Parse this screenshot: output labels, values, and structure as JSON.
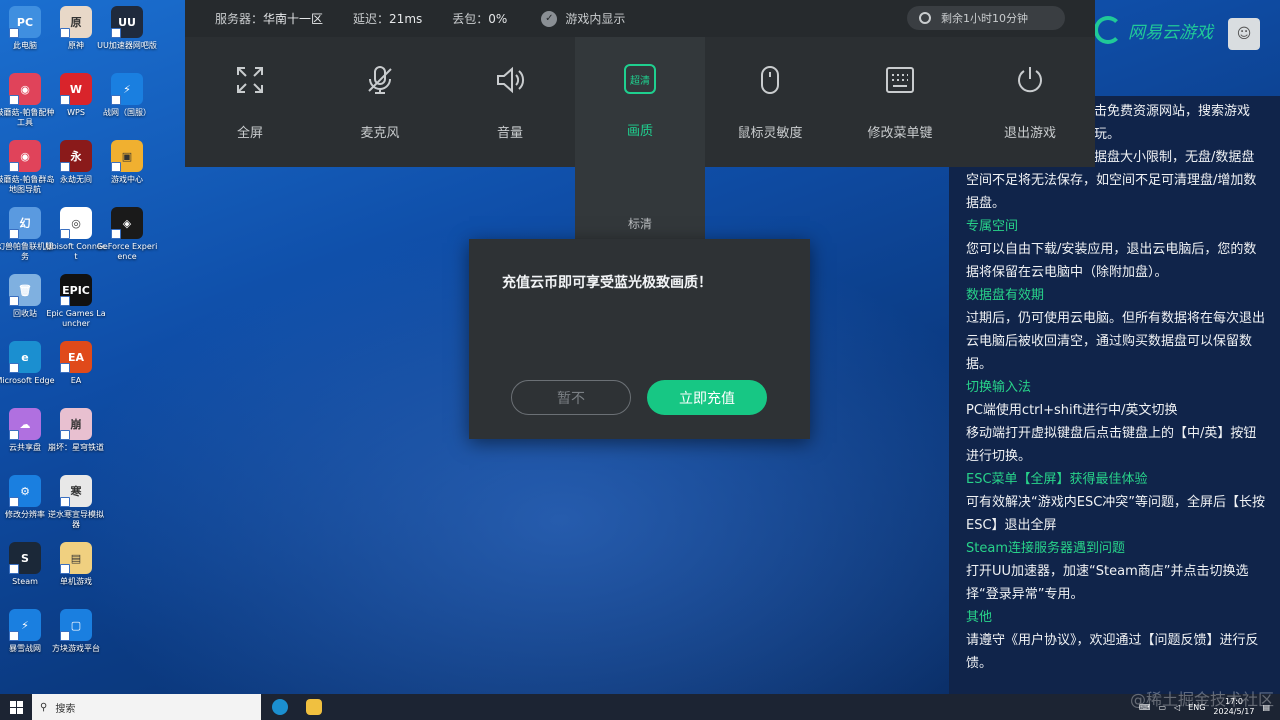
{
  "desktop_icons": [
    {
      "label": "此电脑",
      "color": "#3f8fe0",
      "glyph": "PC",
      "col": 0,
      "row": 0
    },
    {
      "label": "原神",
      "color": "#e8d8c8",
      "glyph": "原",
      "col": 1,
      "row": 0
    },
    {
      "label": "UU加速器网吧版",
      "color": "#1f2a3d",
      "glyph": "UU",
      "col": 2,
      "row": 0
    },
    {
      "label": "鼓蘑菇-帕鲁配种工具",
      "color": "#e0435a",
      "glyph": "◉",
      "col": 0,
      "row": 1
    },
    {
      "label": "WPS",
      "color": "#d9242b",
      "glyph": "W",
      "col": 1,
      "row": 1
    },
    {
      "label": "战网（国服）",
      "color": "#1a7fe0",
      "glyph": "⚡",
      "col": 2,
      "row": 1
    },
    {
      "label": "鼓蘑菇-帕鲁群岛地图导航",
      "color": "#e0435a",
      "glyph": "◉",
      "col": 0,
      "row": 2
    },
    {
      "label": "永劫无间",
      "color": "#8a1a1a",
      "glyph": "永",
      "col": 1,
      "row": 2
    },
    {
      "label": "游戏中心",
      "color": "#f0b030",
      "glyph": "▣",
      "col": 2,
      "row": 2
    },
    {
      "label": "幻兽帕鲁联机服务",
      "color": "#5a9ae0",
      "glyph": "幻",
      "col": 0,
      "row": 3
    },
    {
      "label": "Ubisoft Connect",
      "color": "#ffffff",
      "glyph": "◎",
      "col": 1,
      "row": 3
    },
    {
      "label": "GeForce Experience",
      "color": "#1a1a1a",
      "glyph": "◈",
      "col": 2,
      "row": 3
    },
    {
      "label": "回收站",
      "color": "#7fb0e0",
      "glyph": "🗑",
      "col": 0,
      "row": 4
    },
    {
      "label": "Epic Games Launcher",
      "color": "#111111",
      "glyph": "EPIC",
      "col": 1,
      "row": 4
    },
    {
      "label": "Microsoft Edge",
      "color": "#1b8fd0",
      "glyph": "e",
      "col": 0,
      "row": 5
    },
    {
      "label": "EA",
      "color": "#e04a1a",
      "glyph": "EA",
      "col": 1,
      "row": 5
    },
    {
      "label": "云共享盘",
      "color": "#b070e0",
      "glyph": "☁",
      "col": 0,
      "row": 6
    },
    {
      "label": "崩坏：星穹铁道",
      "color": "#e8c0d0",
      "glyph": "崩",
      "col": 1,
      "row": 6
    },
    {
      "label": "修改分辨率",
      "color": "#1a7fe0",
      "glyph": "⚙",
      "col": 0,
      "row": 7
    },
    {
      "label": "逆水寒宣导模拟器",
      "color": "#e8e8e8",
      "glyph": "寒",
      "col": 1,
      "row": 7
    },
    {
      "label": "Steam",
      "color": "#1b2838",
      "glyph": "S",
      "col": 0,
      "row": 8
    },
    {
      "label": "单机游戏",
      "color": "#f0d080",
      "glyph": "▤",
      "col": 1,
      "row": 8
    },
    {
      "label": "暴雪战网",
      "color": "#1a7fe0",
      "glyph": "⚡",
      "col": 0,
      "row": 9
    },
    {
      "label": "方块游戏平台",
      "color": "#1a7fe0",
      "glyph": "▢",
      "col": 1,
      "row": 9
    }
  ],
  "topbar": {
    "server_label": "服务器：",
    "server_value": "华南十一区",
    "latency_label": "延迟：",
    "latency_value": "21ms",
    "loss_label": "丢包：",
    "loss_value": "0%",
    "show_in_game": "游戏内显示",
    "remaining": "剩余1小时10分钟"
  },
  "tools": [
    {
      "name": "fullscreen",
      "label": "全屏",
      "icon": "fullscreen-icon"
    },
    {
      "name": "microphone",
      "label": "麦克风",
      "icon": "microphone-muted-icon"
    },
    {
      "name": "volume",
      "label": "音量",
      "icon": "speaker-icon"
    },
    {
      "name": "quality",
      "label": "画质",
      "icon": "hd-badge-icon",
      "badge": "超清",
      "active": true
    },
    {
      "name": "mouse-sensitivity",
      "label": "鼠标灵敏度",
      "icon": "mouse-icon"
    },
    {
      "name": "edit-menu-key",
      "label": "修改菜单键",
      "icon": "keyboard-icon"
    },
    {
      "name": "exit-game",
      "label": "退出游戏",
      "icon": "power-icon"
    }
  ],
  "quality_option": "标清",
  "brand": {
    "name": "网易云游戏"
  },
  "info_partial": [
    "击免费资源网站，搜索游戏",
    "玩。",
    "据盘大小限制，无盘/数据盘"
  ],
  "info_items": [
    {
      "type": "text",
      "text": "空间不足将无法保存，如空间不足可清理盘/增加数据盘。"
    },
    {
      "type": "head",
      "text": "专属空间"
    },
    {
      "type": "text",
      "text": "您可以自由下载/安装应用，退出云电脑后，您的数据将保留在云电脑中（除附加盘）。"
    },
    {
      "type": "head",
      "text": "数据盘有效期"
    },
    {
      "type": "text",
      "text": "过期后，仍可使用云电脑。但所有数据将在每次退出云电脑后被收回清空，通过购买数据盘可以保留数据。"
    },
    {
      "type": "head",
      "text": "切换输入法"
    },
    {
      "type": "text",
      "text": "PC端使用ctrl+shift进行中/英文切换"
    },
    {
      "type": "text",
      "text": "移动端打开虚拟键盘后点击键盘上的【中/英】按钮进行切换。"
    },
    {
      "type": "head",
      "text": "ESC菜单【全屏】获得最佳体验"
    },
    {
      "type": "text",
      "text": "可有效解决“游戏内ESC冲突”等问题，全屏后【长按ESC】退出全屏"
    },
    {
      "type": "head",
      "text": "Steam连接服务器遇到问题"
    },
    {
      "type": "text",
      "text": "打开UU加速器，加速“Steam商店”并点击切换选择“登录异常”专用。"
    },
    {
      "type": "head",
      "text": "其他"
    },
    {
      "type": "text",
      "text": "请遵守《用户协议》，欢迎通过【问题反馈】进行反馈。"
    }
  ],
  "modal": {
    "message": "充值云币即可享受蓝光极致画质！",
    "cancel_label": "暂不",
    "confirm_label": "立即充值"
  },
  "taskbar": {
    "search_placeholder": "搜索",
    "lang": "ENG",
    "time": "17:0",
    "date": "2024/5/17"
  },
  "watermark": "@稀土掘金技术社区",
  "colors": {
    "accent": "#17c784",
    "panel": "#2b2f32",
    "info_head": "#28d38a"
  }
}
